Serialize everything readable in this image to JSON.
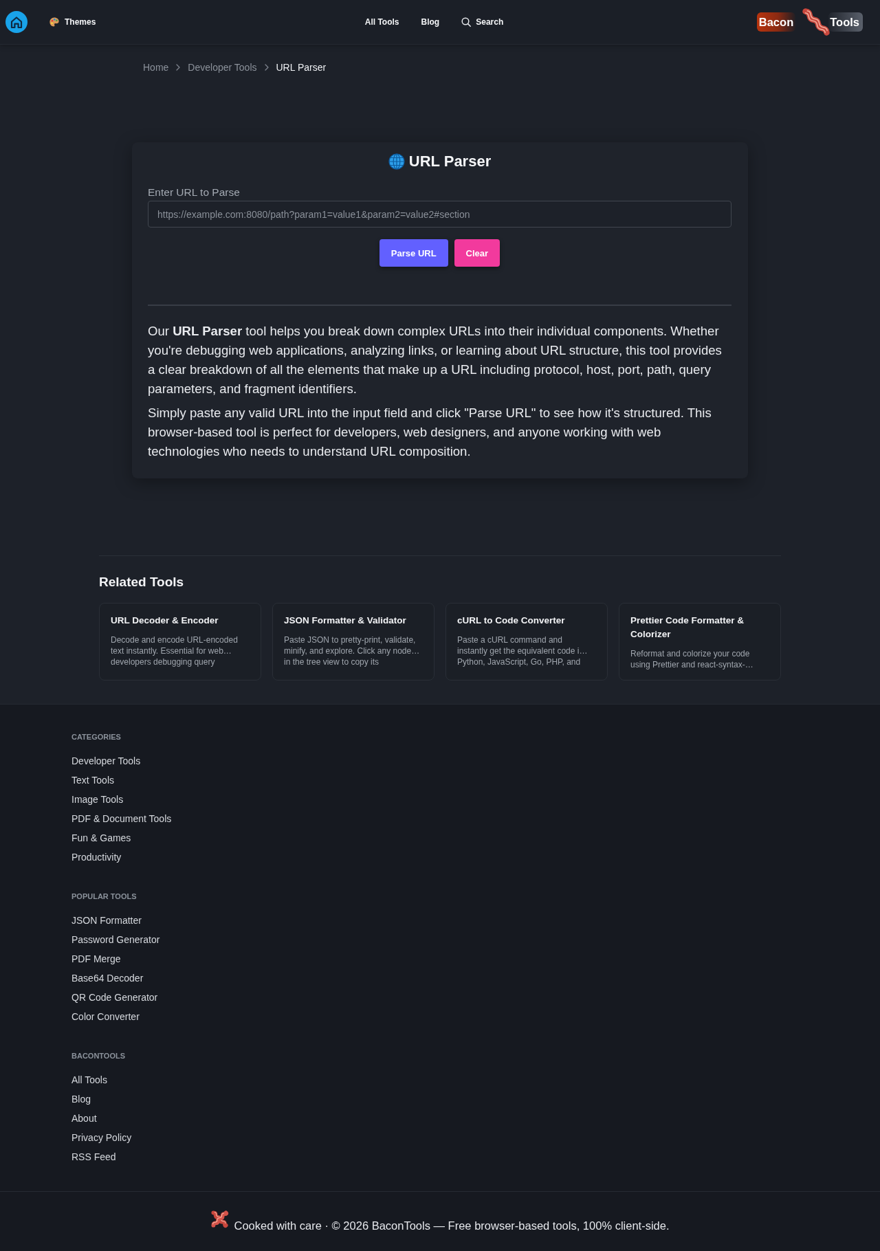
{
  "header": {
    "themes_label": "Themes",
    "nav": [
      {
        "label": "All Tools",
        "kind": "link"
      },
      {
        "label": "Blog",
        "kind": "link"
      },
      {
        "label": "Search",
        "kind": "search"
      }
    ],
    "logo": {
      "left": "Bacon",
      "right": "Tools"
    }
  },
  "breadcrumb": [
    {
      "label": "Home",
      "current": false
    },
    {
      "label": "Developer Tools",
      "current": false
    },
    {
      "label": "URL Parser",
      "current": true
    }
  ],
  "tool": {
    "title": "URL Parser",
    "input": {
      "label": "Enter URL to Parse",
      "placeholder": "https://example.com:8080/path?param1=value1&param2=value2#section"
    },
    "buttons": [
      {
        "label": "Parse URL",
        "kind": "primary"
      },
      {
        "label": "Clear",
        "kind": "danger"
      }
    ],
    "description": [
      "Our **URL Parser** tool helps you break down complex URLs into their individual components. Whether you're debugging web applications, analyzing links, or learning about URL structure, this tool provides a clear breakdown of all the elements that make up a URL including protocol, host, port, path, query parameters, and fragment identifiers.",
      "Simply paste any valid URL into the input field and click \"Parse URL\" to see how it's structured. This browser-based tool is perfect for developers, web designers, and anyone working with web technologies who needs to understand URL composition."
    ]
  },
  "related": {
    "title": "Related Tools",
    "cards": [
      {
        "title": "URL Decoder & Encoder",
        "description": "Decode and encode URL-encoded\ntext instantly. Essential for web…\ndevelopers debugging query"
      },
      {
        "title": "JSON Formatter & Validator",
        "description": "Paste JSON to pretty-print, validate,\nminify, and explore. Click any node…\nin the tree view to copy its"
      },
      {
        "title": "cURL to Code Converter",
        "description": "Paste a cURL command and\ninstantly get the equivalent code i…\nPython, JavaScript, Go, PHP, and"
      },
      {
        "title": "Prettier Code Formatter & Colorizer",
        "description": "Reformat and colorize your code\nusing Prettier and react-syntax-…"
      }
    ]
  },
  "footer": {
    "sections": [
      {
        "heading": "CATEGORIES",
        "links": [
          "Developer Tools",
          "Text Tools",
          "Image Tools",
          "PDF & Document Tools",
          "Fun & Games",
          "Productivity"
        ]
      },
      {
        "heading": "POPULAR TOOLS",
        "links": [
          "JSON Formatter",
          "Password Generator",
          "PDF Merge",
          "Base64 Decoder",
          "QR Code Generator",
          "Color Converter"
        ]
      },
      {
        "heading": "BACONTOOLS",
        "links": [
          "All Tools",
          "Blog",
          "About",
          "Privacy Policy",
          "RSS Feed"
        ]
      }
    ],
    "copyright": "Cooked with care · © 2026 BaconTools — Free browser-based tools, 100% client-side."
  }
}
